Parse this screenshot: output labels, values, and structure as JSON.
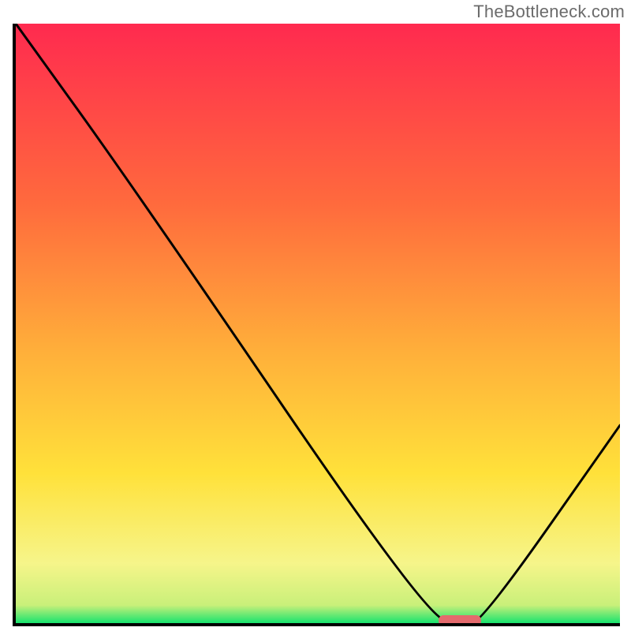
{
  "watermark": "TheBottleneck.com",
  "chart_data": {
    "type": "line",
    "title": "",
    "xlabel": "",
    "ylabel": "",
    "xlim": [
      0,
      1
    ],
    "ylim": [
      0,
      1
    ],
    "background_gradient": {
      "top_color": "#ff2a4f",
      "mid_upper_color": "#ff8c3a",
      "mid_color": "#ffd93a",
      "mid_lower_color": "#f6f58a",
      "bottom_color": "#17e36e"
    },
    "series": [
      {
        "name": "curve",
        "x": [
          0.0,
          0.2,
          0.68,
          0.74,
          0.77,
          1.0
        ],
        "y": [
          1.0,
          0.72,
          0.01,
          0.0,
          0.0,
          0.33
        ]
      }
    ],
    "optimal_marker": {
      "x0": 0.7,
      "x1": 0.77,
      "y": 0.004,
      "color": "#e46a6d"
    }
  }
}
